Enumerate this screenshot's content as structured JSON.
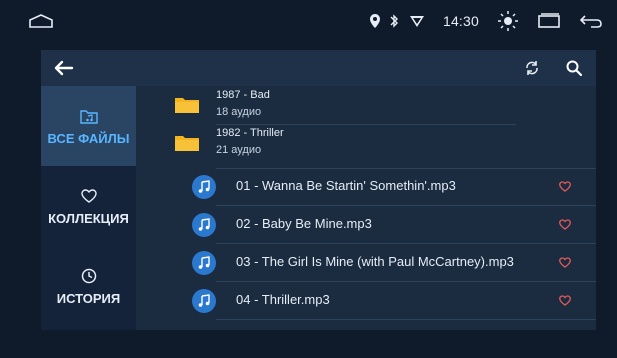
{
  "status_bar": {
    "time": "14:30",
    "icons": [
      "home-icon",
      "location-pin-icon",
      "bluetooth-icon",
      "signal-icon",
      "brightness-icon",
      "recent-apps-icon",
      "back-icon"
    ]
  },
  "toolbar": {
    "back_icon": "back-arrow-icon",
    "refresh_icon": "refresh-icon",
    "search_icon": "search-icon"
  },
  "sidebar": {
    "items": [
      {
        "label": "ВСЕ ФАЙЛЫ",
        "icon": "music-folder-icon",
        "active": true
      },
      {
        "label": "КОЛЛЕКЦИЯ",
        "icon": "heart-outline-icon",
        "active": false
      },
      {
        "label": "ИСТОРИЯ",
        "icon": "clock-icon",
        "active": false
      }
    ]
  },
  "folders": [
    {
      "title": "1987 - Bad",
      "subtitle": "18 аудио",
      "icon": "folder-icon"
    },
    {
      "title": "1982 - Thriller",
      "subtitle": "21 аудио",
      "icon": "folder-icon"
    }
  ],
  "songs": [
    {
      "title": "01 - Wanna Be Startin' Somethin'.mp3",
      "icon": "music-note-icon",
      "favorite_icon": "heart-outline-icon"
    },
    {
      "title": "02 - Baby Be Mine.mp3",
      "icon": "music-note-icon",
      "favorite_icon": "heart-outline-icon"
    },
    {
      "title": "03 - The Girl Is Mine (with Paul McCartney).mp3",
      "icon": "music-note-icon",
      "favorite_icon": "heart-outline-icon"
    },
    {
      "title": "04 - Thriller.mp3",
      "icon": "music-note-icon",
      "favorite_icon": "heart-outline-icon"
    }
  ],
  "colors": {
    "background": "#0f1a2a",
    "panel": "#1b2b40",
    "accent_blue": "#58b6ff",
    "music_icon_bg": "#2b78cf",
    "heart_red": "#e05a5a",
    "folder_yellow": "#f3b41f"
  }
}
